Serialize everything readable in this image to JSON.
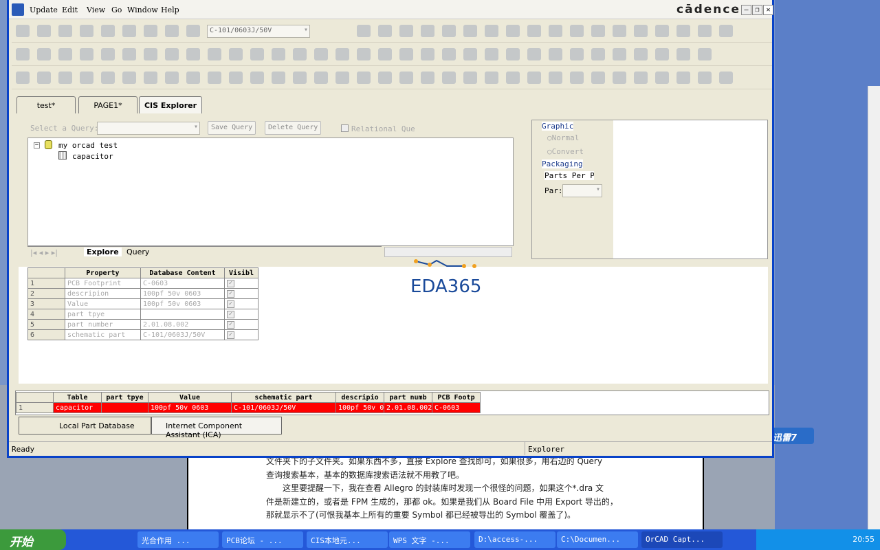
{
  "menu": {
    "items": [
      "Update",
      "Edit",
      "View",
      "Go",
      "Window",
      "Help"
    ],
    "brand": "cādence"
  },
  "toolbar": {
    "part_combo": "C-101/0603J/50V"
  },
  "tabs": [
    "test*",
    "PAGE1*",
    "CIS Explorer"
  ],
  "query": {
    "select_label": "Select a Query:",
    "save": "Save Query",
    "delete": "Delete Query",
    "relational": "Relational Que"
  },
  "tree": {
    "root": "my orcad test",
    "child": "capacitor"
  },
  "explorer_tabs": [
    "Explore",
    "Query"
  ],
  "side": {
    "graphic": "Graphic",
    "normal": "Normal",
    "convert": "Convert",
    "packaging": "Packaging",
    "parts_per": "Parts Per Pk",
    "par": "Par:"
  },
  "properties": {
    "headers": [
      "Property",
      "Database Content",
      "Visibl"
    ],
    "rows": [
      [
        "1",
        "PCB Footprint",
        "C-0603"
      ],
      [
        "2",
        "descripion",
        "100pf 50v 0603"
      ],
      [
        "3",
        "Value",
        "100pf 50v 0603"
      ],
      [
        "4",
        "part tpye",
        ""
      ],
      [
        "5",
        "part number",
        "2.01.08.002"
      ],
      [
        "6",
        "schematic part",
        "C-101/0603J/50V"
      ]
    ]
  },
  "results": {
    "headers": [
      "",
      "Table",
      "part tpye",
      "Value",
      "schematic part",
      "descripio",
      "part numb",
      "PCB Footp"
    ],
    "rows": [
      [
        "1",
        "capacitor",
        "",
        "100pf 50v 0603",
        "C-101/0603J/50V",
        "100pf 50v 0",
        "2.01.08.002",
        "C-0603"
      ]
    ]
  },
  "bottom_tabs": [
    "Local Part Database",
    "Internet Component Assistant (ICA)"
  ],
  "status": {
    "left": "Ready",
    "right": "Explorer"
  },
  "watermark": "EDA365",
  "doc_lines": [
    "文件夹下的子文件夹。如果东西不多，直接 Explore 查找即可，如果很多，用右边的 Query",
    "查询搜索基本，基本的数据库搜索语法就不用教了吧。",
    "　　这里要提醒一下，我在查看 Allegro 的封装库时发现一个很怪的问题，如果这个*.dra 文",
    "件是新建立的，或者是 FPM 生成的，那都 ok。如果是我们从 Board File 中用 Export 导出的，",
    "那就显示不了(可恨我基本上所有的重要 Symbol 都已经被导出的 Symbol 覆盖了)。"
  ],
  "xunlei": "迅雷7",
  "taskbar": {
    "start": "开始",
    "tasks": [
      "光合作用 ...",
      "PCB论坛 - ...",
      "CIS本地元...",
      "WPS 文字 -...",
      "D:\\access-...",
      "C:\\Documen...",
      "OrCAD Capt..."
    ],
    "clock": "20:55"
  }
}
